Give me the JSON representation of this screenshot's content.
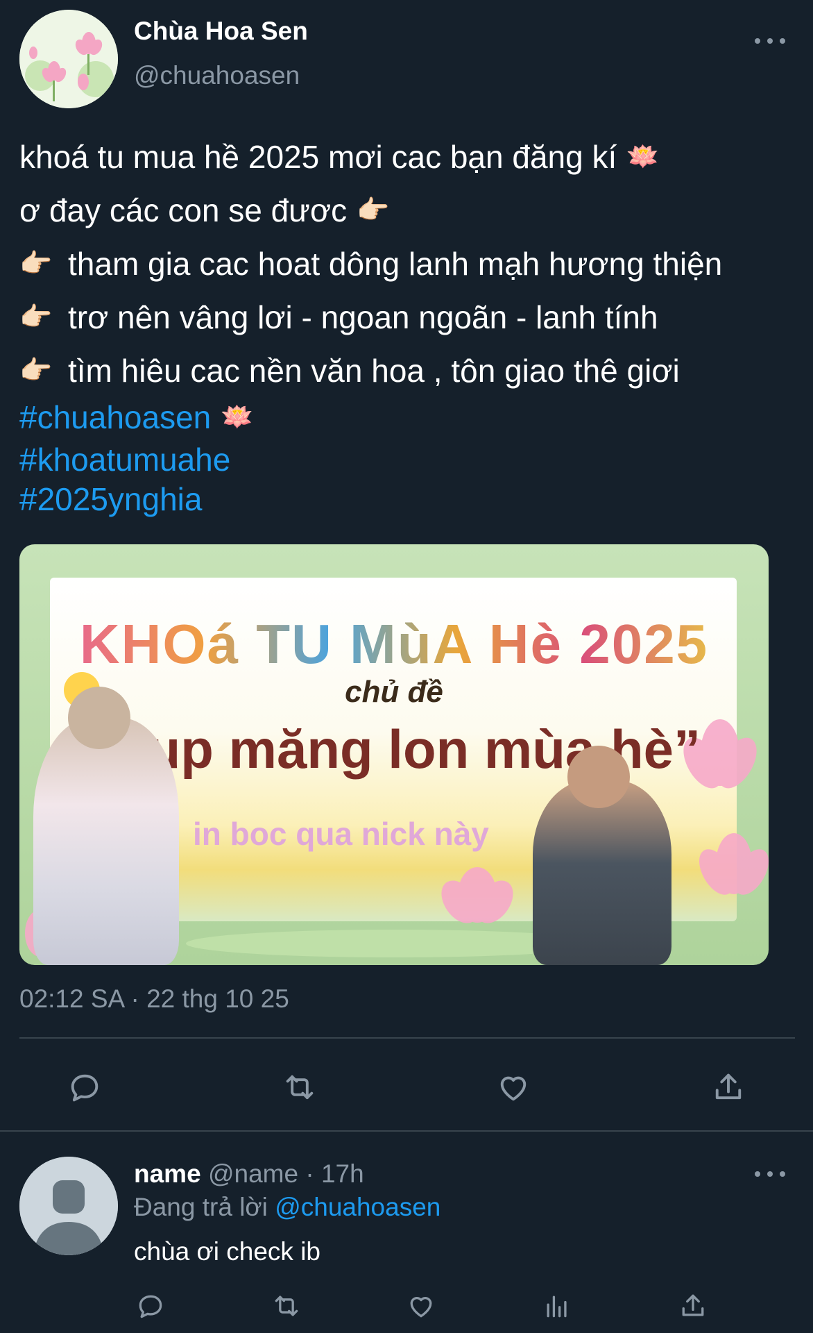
{
  "tweet": {
    "display_name": "Chùa Hoa Sen",
    "handle": "@chuahoasen",
    "lines": [
      "khoá tu mua hề 2025 mơi cac bạn đăng kí",
      "ơ đay các con se đươc",
      "tham gia cac hoat dông lanh mạh hương thiện",
      "trơ nên vâng lơi - ngoan ngoãn - lanh tính",
      "tìm hiêu cac nền văn hoa , tôn giao thê giơi"
    ],
    "emoji": {
      "lotus": "🪷",
      "pointing_hand": "👉🏻"
    },
    "hashtags": [
      "#chuahoasen",
      "#khoatumuahe",
      "#2025ynghia"
    ],
    "timestamp": "02:12 SA · 22 thg 10 25"
  },
  "media": {
    "title": "KHOá TU MùA Hè 2025",
    "theme": "chủ đề",
    "subtitle": "“bup măng lon mùa hè”",
    "overlay": "in boc qua nick này"
  },
  "actions": {
    "icons": [
      "reply-icon",
      "retweet-icon",
      "like-icon",
      "share-icon"
    ]
  },
  "reply": {
    "name": "name",
    "handle": "@name",
    "time": "· 17h",
    "replying_prefix": "Đang trả lời",
    "replying_to": "@chuahoasen",
    "text": "chùa ơi check ib",
    "icons": [
      "reply-icon",
      "retweet-icon",
      "like-icon",
      "views-icon",
      "share-icon"
    ]
  },
  "colors": {
    "background": "#15202b",
    "muted": "#8b98a5",
    "accent": "#1d9bf0",
    "divider": "#38444d"
  }
}
